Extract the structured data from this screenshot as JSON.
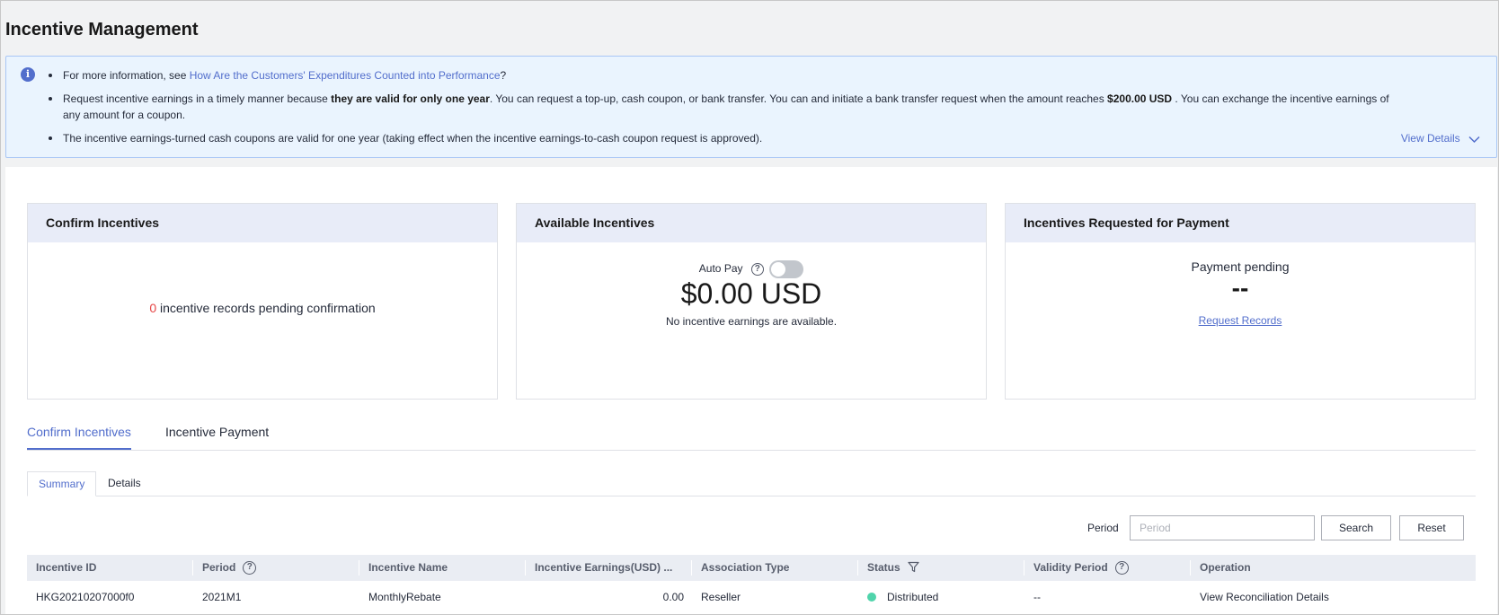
{
  "page": {
    "title": "Incentive Management"
  },
  "notice": {
    "bullet1_prefix": "For more information, see ",
    "bullet1_link": "How Are the Customers' Expenditures Counted into Performance",
    "bullet1_suffix": "?",
    "bullet2_a": "Request incentive earnings in a timely manner because ",
    "bullet2_bold1": "they are valid for only one year",
    "bullet2_b": ". You can request a top-up, cash coupon, or bank transfer. You can and initiate a bank transfer request when the amount reaches ",
    "bullet2_bold2": "$200.00 USD",
    "bullet2_c": " . You can exchange the incentive earnings of any amount for a coupon.",
    "bullet3": "The incentive earnings-turned cash coupons are valid for one year (taking effect when the incentive earnings-to-cash coupon request is approved).",
    "view_details": "View Details"
  },
  "cards": {
    "confirm": {
      "title": "Confirm Incentives",
      "count": "0",
      "text": " incentive records pending confirmation"
    },
    "available": {
      "title": "Available Incentives",
      "auto_pay_label": "Auto Pay",
      "amount": "$0.00 USD",
      "note": "No incentive earnings are available."
    },
    "requested": {
      "title": "Incentives Requested for Payment",
      "status": "Payment pending",
      "value": "--",
      "link": "Request Records"
    }
  },
  "tabs": [
    "Confirm Incentives",
    "Incentive Payment"
  ],
  "subtabs": [
    "Summary",
    "Details"
  ],
  "filter": {
    "label": "Period",
    "placeholder": "Period",
    "search": "Search",
    "reset": "Reset"
  },
  "table": {
    "columns": [
      "Incentive ID",
      "Period",
      "Incentive Name",
      "Incentive Earnings(USD) ...",
      "Association Type",
      "Status",
      "Validity Period",
      "Operation"
    ],
    "rows": [
      {
        "id": "HKG20210207000f0",
        "period": "2021M1",
        "name": "MonthlyRebate",
        "earnings": "0.00",
        "association": "Reseller",
        "status": "Distributed",
        "validity": "--",
        "operation": "View Reconciliation Details"
      }
    ]
  },
  "colors": {
    "accent": "#526ecc",
    "status_distributed": "#50d4ab",
    "count_red": "#e54545"
  }
}
